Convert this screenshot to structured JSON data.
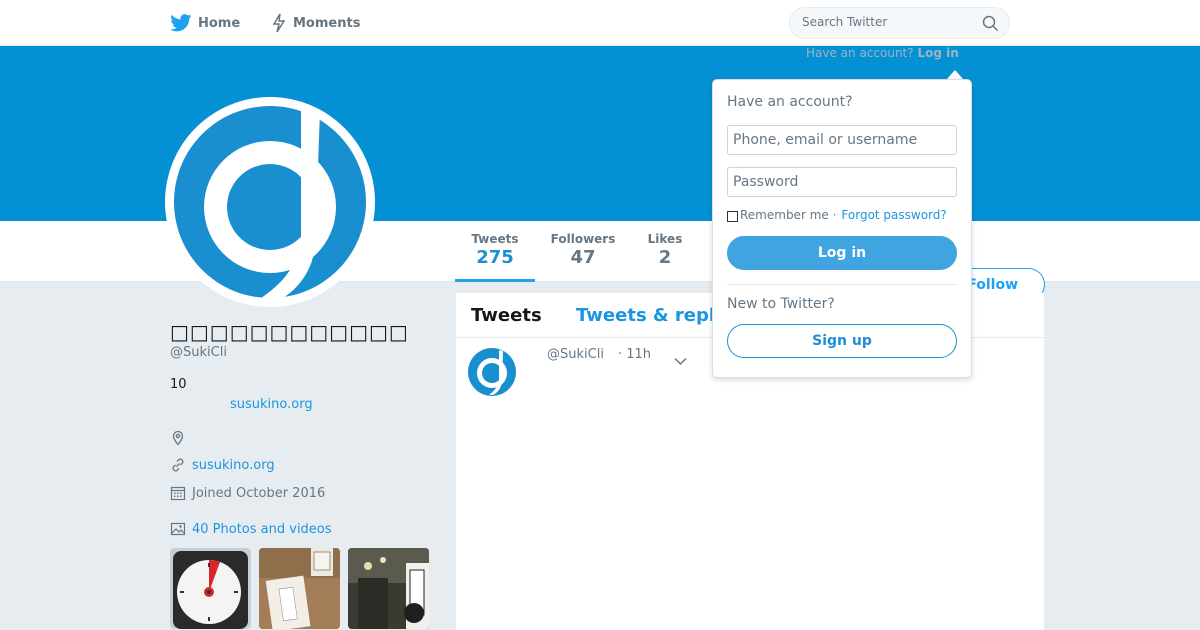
{
  "nav": {
    "home_label": "Home",
    "moments_label": "Moments",
    "search_placeholder": "Search Twitter",
    "have_account_hint": "Have an account?",
    "login_hint_link": "Log in"
  },
  "profile": {
    "display_name": "□□□□□□□□□□□□",
    "handle": "@SukiCli",
    "bio_line1": "10",
    "bio_link": "susukino.org",
    "website": "susukino.org",
    "joined": "Joined October 2016",
    "photos_label": "40 Photos and videos",
    "follow_label": "Follow"
  },
  "stats": {
    "tweets_label": "Tweets",
    "tweets_value": "275",
    "followers_label": "Followers",
    "followers_value": "47",
    "likes_label": "Likes",
    "likes_value": "2"
  },
  "timeline": {
    "tab_tweets": "Tweets",
    "tab_replies": "Tweets & replies",
    "tweet_handle": "@SukiCli",
    "tweet_time": "· 11h"
  },
  "login_dropdown": {
    "title": "Have an account?",
    "username_placeholder": "Phone, email or username",
    "password_placeholder": "Password",
    "remember_label": "Remember me ·",
    "forgot_label": "Forgot password?",
    "login_button": "Log in",
    "new_to_twitter": "New to Twitter?",
    "signup_button": "Sign up"
  },
  "colors": {
    "brand_blue": "#1da1f2",
    "banner_blue": "#0391d4",
    "link_blue": "#1b95e0"
  }
}
